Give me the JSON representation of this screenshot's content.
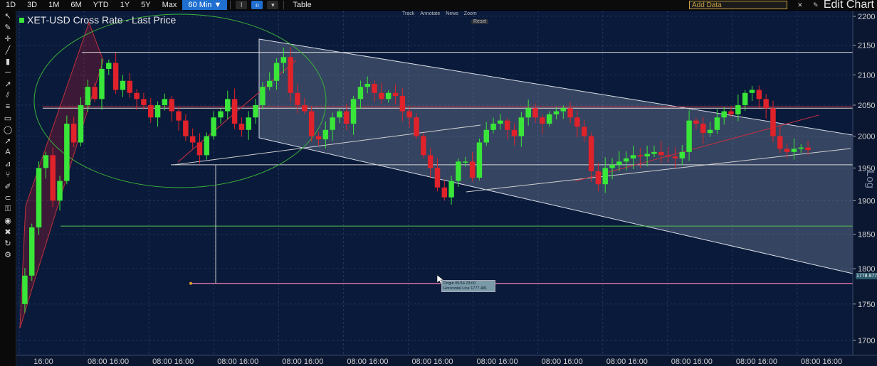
{
  "toolbar": {
    "ranges": [
      "1D",
      "3D",
      "1M",
      "6M",
      "YTD",
      "1Y",
      "5Y",
      "Max"
    ],
    "interval": "60 Min ▼",
    "table_label": "Table",
    "add_data_placeholder": "Add Data",
    "edit_chart_label": "Edit Chart"
  },
  "annotation_bar": {
    "track": "Track",
    "annotate": "Annotate",
    "news": "News",
    "zoom": "Zoom",
    "reset": "Reset"
  },
  "legend": {
    "label": "XET-USD Cross Rate - Last Price",
    "color": "#39e639"
  },
  "price_tag": "1778.977",
  "tooltip": {
    "line1": "Origin 05/14 23:00",
    "line2": "Horizontal Line 1777.481"
  },
  "scale_label": "Log",
  "colors": {
    "background": "#0a1a3a",
    "up": "#39e639",
    "down": "#e0222a",
    "grid": "#23345c",
    "axis_text": "#d0d0d0"
  },
  "chart_data": {
    "type": "candlestick",
    "title": "XET-USD Cross Rate - Last Price",
    "ylim": [
      1680,
      2210
    ],
    "y_ticks": [
      1700,
      1750,
      1800,
      1850,
      1900,
      1950,
      2000,
      2050,
      2100,
      2150,
      2200
    ],
    "y_scale": "log",
    "x_ticks": [
      "16:00",
      "08:00 16:00",
      "08:00 16:00",
      "08:00 16:00",
      "08:00 16:00",
      "08:00 16:00",
      "08:00 16:00",
      "08:00 16:00",
      "08:00 16:00",
      "08:00 16:00",
      "08:00 16:00",
      "08:00 16:00",
      "08:00 16:00"
    ],
    "close_path": [
      1790,
      1860,
      1950,
      1970,
      1900,
      1930,
      2020,
      1990,
      2050,
      2080,
      2060,
      2110,
      2120,
      2075,
      2090,
      2070,
      2060,
      2050,
      2030,
      2050,
      2060,
      2040,
      2025,
      2000,
      1990,
      1970,
      2000,
      2030,
      2040,
      2060,
      2020,
      2010,
      2030,
      2050,
      2080,
      2090,
      2120,
      2130,
      2070,
      2050,
      2040,
      2000,
      1995,
      2010,
      2030,
      2040,
      2020,
      2060,
      2080,
      2085,
      2070,
      2060,
      2070,
      2065,
      2040,
      2030,
      2000,
      1970,
      1950,
      1920,
      1905,
      1930,
      1960,
      1960,
      1935,
      1990,
      2010,
      2020,
      2025,
      2010,
      2000,
      2030,
      2045,
      2030,
      2020,
      2035,
      2040,
      2045,
      2030,
      2015,
      2000,
      1945,
      1925,
      1950,
      1955,
      1960,
      1965,
      1970,
      1968,
      1972,
      1975,
      1970,
      1968,
      1965,
      1975,
      2025,
      2020,
      2005,
      2010,
      2030,
      2040,
      2035,
      2050,
      2070,
      2075,
      2060,
      2045,
      2000,
      1980,
      1975,
      1980,
      1982,
      1978
    ],
    "horizontal_lines": [
      2138,
      2045,
      1955,
      1862,
      1778.977
    ],
    "vertical_line_y": [
      1955,
      1778.977
    ]
  }
}
